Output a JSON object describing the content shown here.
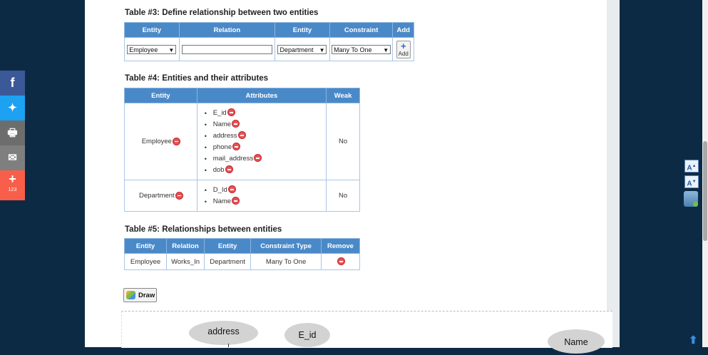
{
  "table3": {
    "caption": "Table #3: Define relationship between two entities",
    "headers": [
      "Entity",
      "Relation",
      "Entity",
      "Constraint",
      "Add"
    ],
    "entity1_value": "Employee",
    "relation_value": "",
    "entity2_value": "Department",
    "constraint_value": "Many To One",
    "add_label": "Add"
  },
  "table4": {
    "caption": "Table #4: Entities and their attributes",
    "headers": [
      "Entity",
      "Attributes",
      "Weak"
    ],
    "rows": [
      {
        "entity": "Employee",
        "attributes": [
          "E_id",
          "Name",
          "address",
          "phone",
          "mail_address",
          "dob"
        ],
        "weak": "No"
      },
      {
        "entity": "Department",
        "attributes": [
          "D_Id",
          "Name"
        ],
        "weak": "No"
      }
    ]
  },
  "table5": {
    "caption": "Table #5: Relationships between entities",
    "headers": [
      "Entity",
      "Relation",
      "Entity",
      "Constraint Type",
      "Remove"
    ],
    "rows": [
      {
        "entity1": "Employee",
        "relation": "Works_In",
        "entity2": "Department",
        "constraint": "Many To One"
      }
    ]
  },
  "draw_button": {
    "label": "Draw"
  },
  "diagram": {
    "nodes": [
      "address",
      "E_id",
      "Name"
    ]
  },
  "social": {
    "items": [
      {
        "icon": "facebook-icon",
        "glyph": "f",
        "color": "#3b5998"
      },
      {
        "icon": "twitter-icon",
        "glyph": "🐦",
        "color": "#1da1f2"
      },
      {
        "icon": "print-icon",
        "glyph": "🖶",
        "color": "#6d6d6d"
      },
      {
        "icon": "email-icon",
        "glyph": "✉",
        "color": "#7f7f7f"
      },
      {
        "icon": "share-more-icon",
        "glyph": "+",
        "color": "#f75f4a"
      }
    ],
    "share_count": "123"
  },
  "right_tools": {
    "increase": "A",
    "decrease": "A"
  },
  "colors": {
    "header_blue": "#4a89c8",
    "page_bg": "#0d2a45"
  }
}
